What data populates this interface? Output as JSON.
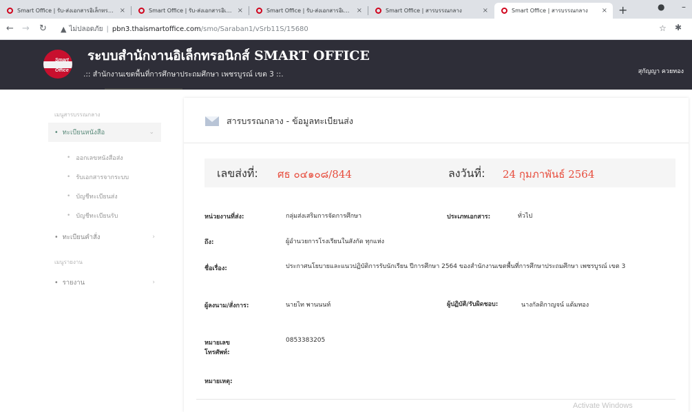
{
  "browser": {
    "tabs": [
      {
        "title": "Smart Office | รับ-ส่งเอกสารอิเล็กทรอนิกส์",
        "active": false
      },
      {
        "title": "Smart Office | รับ-ส่งเอกสารอิเล็กทรอนิกส์",
        "active": false
      },
      {
        "title": "Smart Office | รับ-ส่งเอกสารอิเล็กทรอนิกส์",
        "active": false
      },
      {
        "title": "Smart Office | สารบรรณกลาง",
        "active": false
      },
      {
        "title": "Smart Office | สารบรรณกลาง",
        "active": true
      }
    ],
    "close_glyph": "×",
    "new_tab_glyph": "+",
    "minimize_glyph": "–",
    "address": {
      "security_label": "ไม่ปลอดภัย",
      "host": "pbn3.thaismartoffice.com",
      "path": "/smo/Saraban1/vSrb11S/15680"
    }
  },
  "header": {
    "logo_text_1": "Smart",
    "logo_text_2": "Office",
    "title": "ระบบสำนักงานอิเล็กทรอนิกส์ SMART OFFICE",
    "subtitle": ".:: สำนักงานเขตพื้นที่การศึกษาประถมศึกษา เพชรบูรณ์ เขต 3 ::.",
    "user_name": "สุกัญญา ควยทอง"
  },
  "sidebar": {
    "section1": "เมนูสารบรรณกลาง",
    "item_register": "ทะเบียนหนังสือ",
    "sub_items": [
      "ออกเลขหนังสือส่ง",
      "รับเอกสารจากระบบ",
      "บัญชีทะเบียนส่ง",
      "บัญชีทะเบียนรับ"
    ],
    "item_orders": "ทะเบียนคำสั่ง",
    "section2": "เมนูรายงาน",
    "item_report": "รายงาน"
  },
  "panel": {
    "title": "สารบรรณกลาง - ข้อมูลทะเบียนส่ง",
    "doc_no_label": "เลขส่งที่:",
    "doc_no_value": "ศธ ๐๔๑๐๘/844",
    "date_label": "ลงวันที่:",
    "date_value": "24 กุมภาพันธ์ 2564",
    "fields": {
      "sender_unit_label": "หน่วยงานที่ส่ง:",
      "sender_unit_value": "กลุ่มส่งเสริมการจัดการศึกษา",
      "doc_type_label": "ประเภทเอกสาร:",
      "doc_type_value": "ทั่วไป",
      "to_label": "ถึง:",
      "to_value": "ผู้อำนวยการโรงเรียนในสังกัด ทุกแห่ง",
      "subject_label": "ชื่อเรื่อง:",
      "subject_value": "ประกาศนโยบายและแนวปฏิบัติการรับนักเรียน ปีการศึกษา 2564 ของสำนักงานเขตพื้นที่การศึกษาประถมศึกษา เพชรบูรณ์ เขต 3",
      "signer_label": "ผู้ลงนาม/สั่งการ:",
      "signer_value": "นายไท พานนนท์",
      "responsible_label": "ผู้ปฏิบัติ/รับผิดชอบ:",
      "responsible_value": "นางกัลติกาญจน์ แต้มทอง",
      "phone_label": "หมายเลขโทรศัพท์:",
      "phone_value": "0853383205",
      "note_label": "หมายเหตุ:"
    }
  },
  "watermark": "Activate Windows"
}
